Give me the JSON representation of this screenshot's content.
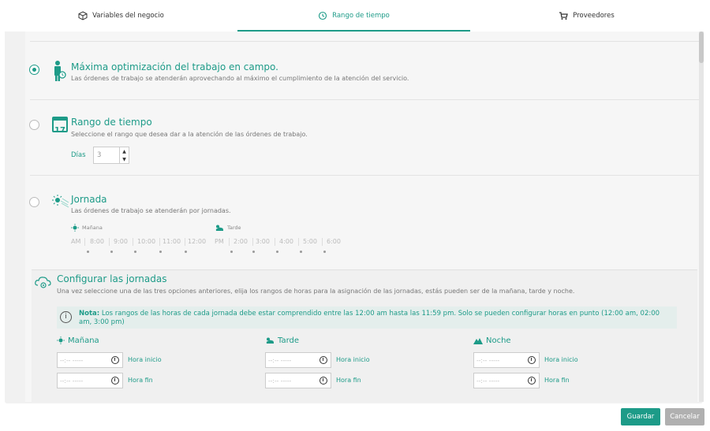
{
  "tabs": [
    {
      "label": "Variables del negocio",
      "icon": "cube-icon"
    },
    {
      "label": "Rango de tiempo",
      "icon": "history-icon",
      "active": true
    },
    {
      "label": "Proveedores",
      "icon": "cart-icon"
    }
  ],
  "options": {
    "max": {
      "title": "Máxima optimización del trabajo en campo.",
      "desc": "Las órdenes de trabajo se atenderán aprovechando al máximo el cumplimiento de la atención del servicio.",
      "selected": true
    },
    "rango": {
      "title": "Rango de tiempo",
      "desc": "Seleccione el rango que desea dar a la atención de las órdenes de trabajo.",
      "dias_label": "Días",
      "dias_value": "3",
      "calendar_day": "17"
    },
    "jornada": {
      "title": "Jornada",
      "desc": "Las órdenes de trabajo se atenderán por jornadas.",
      "manana_label": "Mañana",
      "tarde_label": "Tarde",
      "am": [
        "AM",
        "8:00",
        "9:00",
        "10:00",
        "11:00",
        "12:00"
      ],
      "pm": [
        "PM",
        "2:00",
        "3:00",
        "4:00",
        "5:00",
        "6:00"
      ]
    }
  },
  "config": {
    "title": "Configurar las jornadas",
    "desc": "Una vez seleccione una de las tres opciones anteriores, elija los rangos de horas para la asignación de las jornadas, estás pueden ser de la mañana, tarde y noche.",
    "note_icon": "i",
    "note_bold": "Nota:",
    "note_text": " Los rangos de las horas de cada jornada debe estar comprendido entre las 12:00 am hasta las 11:59 pm. Solo se pueden configurar horas en punto (12:00 am, 02:00 am, 3:00 pm)",
    "shifts": [
      {
        "title": "Mañana",
        "icon": "sun-icon",
        "start_placeholder": "--:-- -----",
        "end_placeholder": "--:-- -----",
        "start_label": "Hora inicio",
        "end_label": "Hora fin"
      },
      {
        "title": "Tarde",
        "icon": "cloud-sun-icon",
        "start_placeholder": "--:-- -----",
        "end_placeholder": "--:-- -----",
        "start_label": "Hora inicio",
        "end_label": "Hora fin"
      },
      {
        "title": "Noche",
        "icon": "mountain-icon",
        "start_placeholder": "--:-- -----",
        "end_placeholder": "--:-- -----",
        "start_label": "Hora inicio",
        "end_label": "Hora fin"
      }
    ]
  },
  "buttons": {
    "save": "Guardar",
    "cancel": "Cancelar"
  },
  "colors": {
    "accent": "#1d9b88",
    "cancel": "#b0b0b0"
  }
}
